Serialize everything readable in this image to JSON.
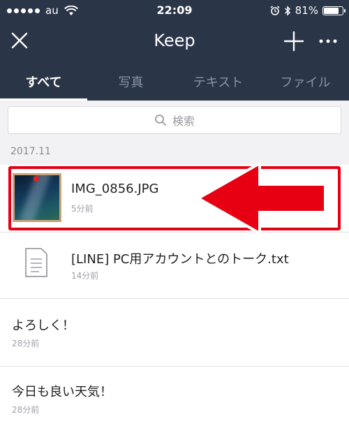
{
  "status_bar": {
    "carrier": "au",
    "time": "22:09",
    "battery_percent": "81%",
    "battery_level": 0.81
  },
  "nav": {
    "title": "Keep",
    "close_icon": "close-icon",
    "add_icon": "plus-icon",
    "more_icon": "more-icon"
  },
  "tabs": [
    {
      "label": "すべて",
      "active": true
    },
    {
      "label": "写真",
      "active": false
    },
    {
      "label": "テキスト",
      "active": false
    },
    {
      "label": "ファイル",
      "active": false
    }
  ],
  "search": {
    "placeholder": "検索",
    "icon": "search-icon"
  },
  "date_section": "2017.11",
  "items": [
    {
      "title": "IMG_0856.JPG",
      "time": "5分前",
      "type": "image"
    },
    {
      "title": "[LINE] PC用アカウントとのトーク.txt",
      "time": "14分前",
      "type": "file"
    },
    {
      "title": "よろしく！",
      "time": "28分前",
      "type": "text"
    },
    {
      "title": "今日も良い天気！",
      "time": "28分前",
      "type": "text"
    }
  ],
  "colors": {
    "header_bg": "#2b3548",
    "highlight": "#e60012",
    "list_bg": "#f2f2f4"
  }
}
